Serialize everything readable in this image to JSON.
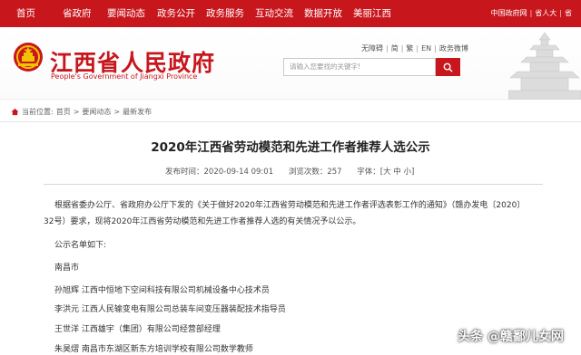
{
  "topnav": [
    "首页",
    "省政府",
    "要闻动态",
    "政务公开",
    "政务服务",
    "互动交流",
    "数据开放",
    "美丽江西"
  ],
  "toplinks": [
    "中国政府网",
    "省人大",
    "省"
  ],
  "header": {
    "title": "江西省人民政府",
    "subtitle": "People's Government of Jiangxi Province",
    "util_links": [
      "无障碍",
      "简",
      "繁",
      "EN",
      "政务微博"
    ],
    "search_placeholder": "请输入您要找的关键字!"
  },
  "breadcrumb": {
    "prefix": "当前位置:",
    "items": [
      "首页",
      "要闻动态",
      "最新发布"
    ]
  },
  "article": {
    "title": "2020年江西省劳动模范和先进工作者推荐人选公示",
    "publish_time": "发布时间：2020-09-14 09:01",
    "views": "浏览次数：257",
    "font_size_label": "字体：",
    "font_sizes": [
      "[大",
      "中",
      "小]"
    ],
    "paragraphs": [
      "根据省委办公厅、省政府办公厅下发的《关于做好2020年江西省劳动模范和先进工作者评选表彰工作的通知》（赣办发电〔2020〕",
      "32号）要求，现将2020年江西省劳动模范和先进工作者推荐人选的有关情况予以公示。",
      "公示名单如下:",
      "南昌市",
      "孙旭辉 江西中恒地下空间科技有限公司机械设备中心技术员",
      "李洪元 江西人民输变电有限公司总装车间变压器装配技术指导员",
      "王世洋 江西雄宇（集团）有限公司经营部经理",
      "朱昊熠 南昌市东湖区新东方培训学校有限公司数学教师"
    ]
  },
  "watermark": "头条 @赣鄱儿女网",
  "colors": {
    "brand_red": "#c8161d"
  }
}
